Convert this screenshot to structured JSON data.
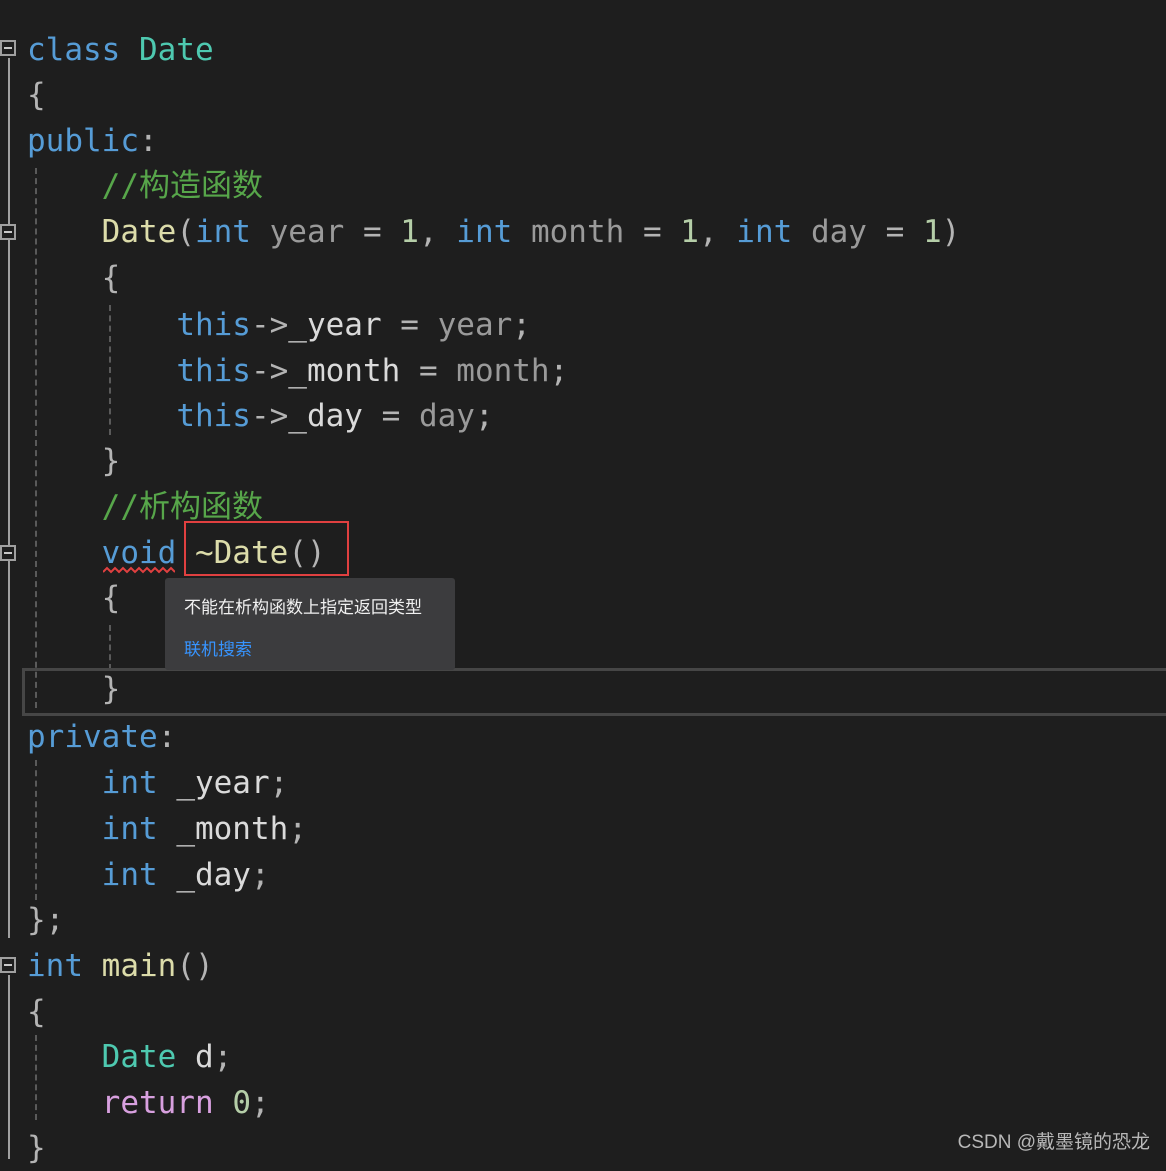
{
  "editor": {
    "lines": [
      [
        [
          "class ",
          "kw"
        ],
        [
          "Date",
          "ty"
        ]
      ],
      [
        [
          "{",
          "pu"
        ]
      ],
      [
        [
          "public",
          "kw"
        ],
        [
          ":",
          "pu"
        ]
      ],
      [
        [
          "    ",
          ""
        ],
        [
          "//构造函数",
          "cm"
        ]
      ],
      [
        [
          "    ",
          ""
        ],
        [
          "Date",
          "fn"
        ],
        [
          "(",
          "pu"
        ],
        [
          "int",
          "kw"
        ],
        [
          " year ",
          "pa"
        ],
        [
          "= ",
          "pu"
        ],
        [
          "1",
          "nu"
        ],
        [
          ", ",
          "pu"
        ],
        [
          "int",
          "kw"
        ],
        [
          " month ",
          "pa"
        ],
        [
          "= ",
          "pu"
        ],
        [
          "1",
          "nu"
        ],
        [
          ", ",
          "pu"
        ],
        [
          "int",
          "kw"
        ],
        [
          " day ",
          "pa"
        ],
        [
          "= ",
          "pu"
        ],
        [
          "1",
          "nu"
        ],
        [
          ")",
          "pu"
        ]
      ],
      [
        [
          "    ",
          ""
        ],
        [
          "{",
          "pu"
        ]
      ],
      [
        [
          "        ",
          ""
        ],
        [
          "this",
          "kw"
        ],
        [
          "->",
          "pu"
        ],
        [
          "_year",
          "mb"
        ],
        [
          " = ",
          "pu"
        ],
        [
          "year",
          "pa"
        ],
        [
          ";",
          "pu"
        ]
      ],
      [
        [
          "        ",
          ""
        ],
        [
          "this",
          "kw"
        ],
        [
          "->",
          "pu"
        ],
        [
          "_month",
          "mb"
        ],
        [
          " = ",
          "pu"
        ],
        [
          "month",
          "pa"
        ],
        [
          ";",
          "pu"
        ]
      ],
      [
        [
          "        ",
          ""
        ],
        [
          "this",
          "kw"
        ],
        [
          "->",
          "pu"
        ],
        [
          "_day",
          "mb"
        ],
        [
          " = ",
          "pu"
        ],
        [
          "day",
          "pa"
        ],
        [
          ";",
          "pu"
        ]
      ],
      [
        [
          "    ",
          ""
        ],
        [
          "}",
          "pu"
        ]
      ],
      [
        [
          "    ",
          ""
        ],
        [
          "//析构函数",
          "cm"
        ]
      ],
      [
        [
          "    ",
          ""
        ],
        [
          "void",
          "kw"
        ],
        [
          " ",
          ""
        ],
        [
          "~Date",
          "fn"
        ],
        [
          "()",
          "pu"
        ]
      ],
      [
        [
          "    ",
          ""
        ],
        [
          "{",
          "pu"
        ]
      ],
      [],
      [
        [
          "    ",
          ""
        ],
        [
          "}",
          "pu"
        ]
      ],
      [
        [
          "private",
          "kw"
        ],
        [
          ":",
          "pu"
        ]
      ],
      [
        [
          "    ",
          ""
        ],
        [
          "int",
          "kw"
        ],
        [
          " _year",
          "mb"
        ],
        [
          ";",
          "pu"
        ]
      ],
      [
        [
          "    ",
          ""
        ],
        [
          "int",
          "kw"
        ],
        [
          " _month",
          "mb"
        ],
        [
          ";",
          "pu"
        ]
      ],
      [
        [
          "    ",
          ""
        ],
        [
          "int",
          "kw"
        ],
        [
          " _day",
          "mb"
        ],
        [
          ";",
          "pu"
        ]
      ],
      [
        [
          "};",
          "pu"
        ]
      ],
      [
        [
          "int",
          "kw"
        ],
        [
          " ",
          ""
        ],
        [
          "main",
          "fn"
        ],
        [
          "()",
          "pu"
        ]
      ],
      [
        [
          "{",
          "pu"
        ]
      ],
      [
        [
          "    ",
          ""
        ],
        [
          "Date",
          "ty"
        ],
        [
          " d",
          "mb"
        ],
        [
          ";",
          "pu"
        ]
      ],
      [
        [
          "    ",
          ""
        ],
        [
          "return",
          "rt"
        ],
        [
          " ",
          ""
        ],
        [
          "0",
          "nu"
        ],
        [
          ";",
          "pu"
        ]
      ],
      [
        [
          "}",
          "pu"
        ]
      ]
    ],
    "error_color": "#e04040"
  },
  "tooltip": {
    "message": "不能在析构函数上指定返回类型",
    "link": "联机搜索"
  },
  "watermark": "CSDN @戴墨镜的恐龙"
}
